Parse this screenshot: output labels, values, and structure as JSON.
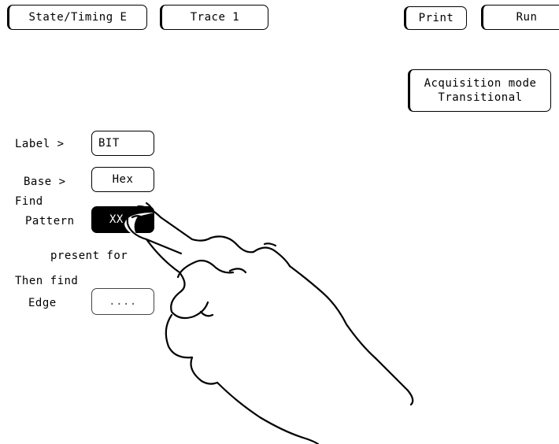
{
  "top_bar": {
    "menu_label": "State/Timing E",
    "trace_label": "Trace 1",
    "print_label": "Print",
    "run_label": "Run"
  },
  "acquisition": {
    "line1": "Acquisition mode",
    "line2": "Transitional"
  },
  "trace_spec": {
    "label_caption": "Label >",
    "label_value": "BIT",
    "base_caption": "Base >",
    "base_value": "Hex",
    "find_caption": "Find",
    "pattern_caption": "Pattern",
    "pattern_value": "XX",
    "present_for_caption": "present for",
    "then_find_caption": "Then find",
    "edge_caption": "Edge",
    "edge_value": "...."
  }
}
